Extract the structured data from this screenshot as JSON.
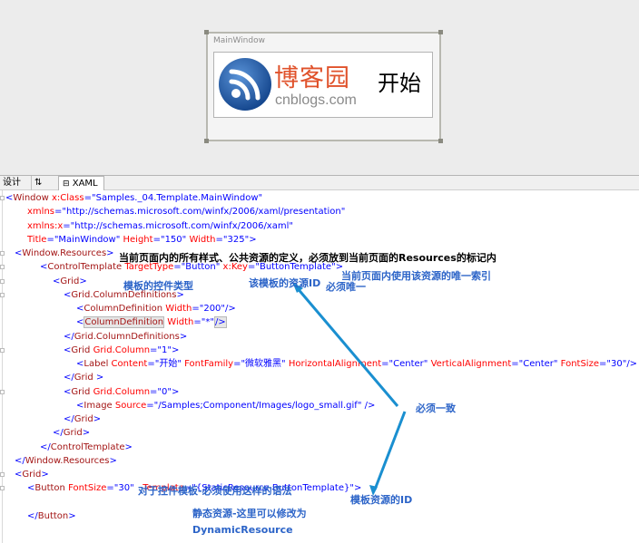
{
  "designer": {
    "window_title": "MainWindow",
    "logo_cn": "博客园",
    "logo_en": "cnblogs.com",
    "button_text": "开始",
    "logo_color": "#e0522b"
  },
  "tabs": {
    "design": "设计",
    "swap": "⇅",
    "xaml": "XAML"
  },
  "code": [
    [
      [
        "br",
        "<"
      ],
      [
        "el",
        "Window"
      ],
      [
        "at",
        " x:Class"
      ],
      [
        "br",
        "="
      ],
      [
        "va",
        "\"Samples._04.Template.MainWindow\""
      ]
    ],
    [
      [
        "at",
        "xmlns"
      ],
      [
        "br",
        "="
      ],
      [
        "va",
        "\"http://schemas.microsoft.com/winfx/2006/xaml/presentation\""
      ]
    ],
    [
      [
        "at",
        "xmlns:x"
      ],
      [
        "br",
        "="
      ],
      [
        "va",
        "\"http://schemas.microsoft.com/winfx/2006/xaml\""
      ]
    ],
    [
      [
        "at",
        "Title"
      ],
      [
        "br",
        "="
      ],
      [
        "va",
        "\"MainWindow\""
      ],
      [
        "at",
        " Height"
      ],
      [
        "br",
        "="
      ],
      [
        "va",
        "\"150\""
      ],
      [
        "at",
        " Width"
      ],
      [
        "br",
        "="
      ],
      [
        "va",
        "\"325\""
      ],
      [
        "br",
        ">"
      ]
    ],
    [
      [
        "br",
        "<"
      ],
      [
        "el",
        "Window.Resources"
      ],
      [
        "br",
        ">"
      ]
    ],
    [
      [
        "br",
        "<"
      ],
      [
        "el",
        "ControlTemplate"
      ],
      [
        "at",
        " TargetType"
      ],
      [
        "br",
        "="
      ],
      [
        "va",
        "\"Button\""
      ],
      [
        "at",
        " x:Key"
      ],
      [
        "br",
        "="
      ],
      [
        "va",
        "\"ButtonTemplate\""
      ],
      [
        "br",
        ">"
      ]
    ],
    [
      [
        "br",
        "<"
      ],
      [
        "el",
        "Grid"
      ],
      [
        "br",
        ">"
      ]
    ],
    [
      [
        "br",
        "<"
      ],
      [
        "el",
        "Grid.ColumnDefinitions"
      ],
      [
        "br",
        ">"
      ]
    ],
    [
      [
        "br",
        "<"
      ],
      [
        "el",
        "ColumnDefinition"
      ],
      [
        "at",
        " Width"
      ],
      [
        "br",
        "="
      ],
      [
        "va",
        "\"200\""
      ],
      [
        "br",
        "/>"
      ]
    ],
    [
      [
        "br",
        "<"
      ],
      [
        "el",
        "ColumnDefinition"
      ],
      [
        "at",
        " Width"
      ],
      [
        "br",
        "="
      ],
      [
        "va",
        "\"*\""
      ],
      [
        "br",
        "/>"
      ]
    ],
    [
      [
        "br",
        "</"
      ],
      [
        "el",
        "Grid.ColumnDefinitions"
      ],
      [
        "br",
        ">"
      ]
    ],
    [
      [
        "br",
        "<"
      ],
      [
        "el",
        "Grid"
      ],
      [
        "at",
        " Grid.Column"
      ],
      [
        "br",
        "="
      ],
      [
        "va",
        "\"1\""
      ],
      [
        "br",
        ">"
      ]
    ],
    [
      [
        "br",
        "<"
      ],
      [
        "el",
        "Label"
      ],
      [
        "at",
        " Content"
      ],
      [
        "br",
        "="
      ],
      [
        "va",
        "\"开始\""
      ],
      [
        "at",
        " FontFamily"
      ],
      [
        "br",
        "="
      ],
      [
        "va",
        "\"微软雅黑\""
      ],
      [
        "at",
        " HorizontalAlignment"
      ],
      [
        "br",
        "="
      ],
      [
        "va",
        "\"Center\""
      ],
      [
        "at",
        " VerticalAlignment"
      ],
      [
        "br",
        "="
      ],
      [
        "va",
        "\"Center\""
      ],
      [
        "at",
        " FontSize"
      ],
      [
        "br",
        "="
      ],
      [
        "va",
        "\"30\""
      ],
      [
        "br",
        "/>"
      ]
    ],
    [
      [
        "br",
        "</"
      ],
      [
        "el",
        "Grid"
      ],
      [
        "br",
        " >"
      ]
    ],
    [
      [
        "br",
        "<"
      ],
      [
        "el",
        "Grid"
      ],
      [
        "at",
        " Grid.Column"
      ],
      [
        "br",
        "="
      ],
      [
        "va",
        "\"0\""
      ],
      [
        "br",
        ">"
      ]
    ],
    [
      [
        "br",
        "<"
      ],
      [
        "el",
        "Image"
      ],
      [
        "at",
        " Source"
      ],
      [
        "br",
        "="
      ],
      [
        "va",
        "\"/Samples;Component/Images/logo_small.gif\""
      ],
      [
        "br",
        " />"
      ]
    ],
    [
      [
        "br",
        "</"
      ],
      [
        "el",
        "Grid"
      ],
      [
        "br",
        ">"
      ]
    ],
    [
      [
        "br",
        "</"
      ],
      [
        "el",
        "Grid"
      ],
      [
        "br",
        ">"
      ]
    ],
    [
      [
        "br",
        "</"
      ],
      [
        "el",
        "ControlTemplate"
      ],
      [
        "br",
        ">"
      ]
    ],
    [
      [
        "br",
        "</"
      ],
      [
        "el",
        "Window.Resources"
      ],
      [
        "br",
        ">"
      ]
    ],
    [
      [
        "br",
        "<"
      ],
      [
        "el",
        "Grid"
      ],
      [
        "br",
        ">"
      ]
    ],
    [
      [
        "br",
        "<"
      ],
      [
        "el",
        "Button"
      ],
      [
        "at",
        " FontSize"
      ],
      [
        "br",
        "="
      ],
      [
        "va",
        "\"30\""
      ],
      [
        "at",
        "   Template"
      ],
      [
        "br",
        "="
      ],
      [
        "va",
        "\"{StaticResource ButtonTemplate}\""
      ],
      [
        "br",
        ">"
      ]
    ],
    [],
    [
      [
        "br",
        "</"
      ],
      [
        "el",
        "Button"
      ],
      [
        "br",
        ">"
      ]
    ]
  ],
  "annotations": {
    "resources_note": "当前页面内的所有样式、公共资源的定义，必须放到当前页面的Resources的标记内",
    "control_type": "模板的控件类型",
    "resource_id": "该模板的资源ID",
    "unique_index": "当前页面内使用该资源的唯一索引",
    "must_unique": "必须唯一",
    "must_match": "必须一致",
    "syntax_note": "对于控件模板-必须使用这样的语法",
    "static_note": "静态资源-这里可以修改为",
    "dynamic": "DynamicResource",
    "template_id": "模板资源的ID"
  }
}
